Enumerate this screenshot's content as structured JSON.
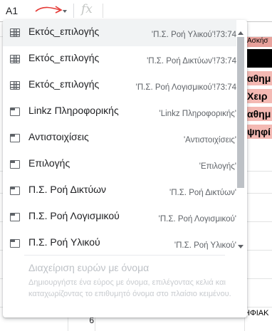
{
  "formula_bar": {
    "name_box_value": "A1",
    "fx_label": "fx"
  },
  "sheet": {
    "header_cell": "Ασκήσ",
    "pink_cells": [
      "αθημ",
      "Χειρ",
      "αθημ",
      "ψηφί"
    ],
    "row_number": "6",
    "bottom_cell": "ΗΦΙΑΚ"
  },
  "named_ranges": {
    "items": [
      {
        "icon": "table-icon",
        "name": "Εκτός_επιλογής",
        "range": "'Π.Σ. Ροή Υλικού'!73:74",
        "selected": true
      },
      {
        "icon": "table-icon",
        "name": "Εκτός_επιλογής",
        "range": "'Π.Σ. Ροή Δικτύων'!73:74"
      },
      {
        "icon": "table-icon",
        "name": "Εκτός_επιλογής",
        "range": "'Π.Σ. Ροή Λογισμικού'!73:74"
      },
      {
        "icon": "sheet-tab-icon",
        "name": "Linkz Πληροφορικής",
        "range": "'Linkz Πληροφορικής'"
      },
      {
        "icon": "sheet-tab-icon",
        "name": "Αντιστοιχίσεις",
        "range": "'Αντιστοιχίσεις'"
      },
      {
        "icon": "sheet-tab-icon",
        "name": "Επιλογής",
        "range": "'Επιλογής'"
      },
      {
        "icon": "sheet-tab-icon",
        "name": "Π.Σ. Ροή Δικτύων",
        "range": "'Π.Σ. Ροή Δικτύων'"
      },
      {
        "icon": "sheet-tab-icon",
        "name": "Π.Σ. Ροή Λογισμικού",
        "range": "'Π.Σ. Ροή Λογισμικού'"
      },
      {
        "icon": "sheet-tab-icon",
        "name": "Π.Σ. Ροή Υλικού",
        "range": "'Π.Σ. Ροή Υλικού'"
      }
    ],
    "footer_title": "Διαχείριση ευρών με όνομα",
    "footer_description": "Δημιουργήστε ένα εύρος με όνομα, επιλέγοντας κελιά και καταχωρίζοντας το επιθυμητό όνομα στο πλαίσιο κειμένου."
  },
  "colors": {
    "annotation": "#e53935",
    "header_fill": "#e8a19b",
    "pink_fill": "#f4b9b3"
  }
}
